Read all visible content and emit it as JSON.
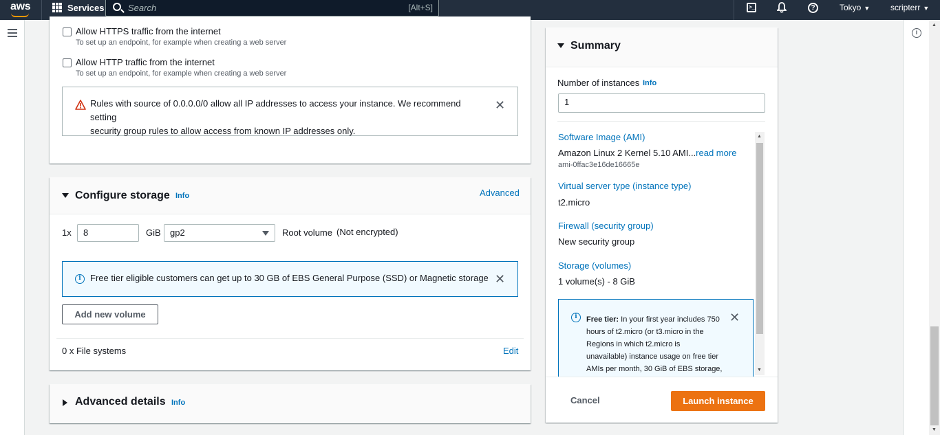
{
  "nav": {
    "logo": "aws",
    "services": "Services",
    "search_placeholder": "Search",
    "search_shortcut": "[Alt+S]",
    "region": "Tokyo",
    "user": "scripterr"
  },
  "network": {
    "https_label": "Allow HTTPS traffic from the internet",
    "https_desc": "To set up an endpoint, for example when creating a web server",
    "http_label": "Allow HTTP traffic from the internet",
    "http_desc": "To set up an endpoint, for example when creating a web server",
    "warning_line1": "Rules with source of 0.0.0.0/0 allow all IP addresses to access your instance. We recommend setting",
    "warning_line2": "security group rules to allow access from known IP addresses only."
  },
  "storage": {
    "title": "Configure storage",
    "info": "Info",
    "advanced": "Advanced",
    "multiplier": "1x",
    "size": "8",
    "unit": "GiB",
    "volume_type": "gp2",
    "root_label": "Root volume",
    "encryption": "(Not encrypted)",
    "free_tier_msg": "Free tier eligible customers can get up to 30 GB of EBS General Purpose (SSD) or Magnetic storage",
    "add_volume": "Add new volume",
    "file_systems": "0 x File systems",
    "edit": "Edit"
  },
  "advanced": {
    "title": "Advanced details",
    "info": "Info"
  },
  "summary": {
    "title": "Summary",
    "instances_label": "Number of instances",
    "instances_info": "Info",
    "instances_value": "1",
    "ami_label": "Software Image (AMI)",
    "ami_value": "Amazon Linux 2 Kernel 5.10 AMI...",
    "read_more": "read more",
    "ami_id": "ami-0ffac3e16de16665e",
    "type_label": "Virtual server type (instance type)",
    "type_value": "t2.micro",
    "firewall_label": "Firewall (security group)",
    "firewall_value": "New security group",
    "storage_label": "Storage (volumes)",
    "storage_value": "1 volume(s) - 8 GiB",
    "free_tier_title": "Free tier:",
    "free_tier_lines": [
      "In your first year includes 750",
      "hours of t2.micro (or t3.micro in the",
      "Regions in which t2.micro is",
      "unavailable) instance usage on free tier",
      "AMIs per month, 30 GiB of EBS storage,"
    ],
    "cancel": "Cancel",
    "launch": "Launch instance"
  }
}
